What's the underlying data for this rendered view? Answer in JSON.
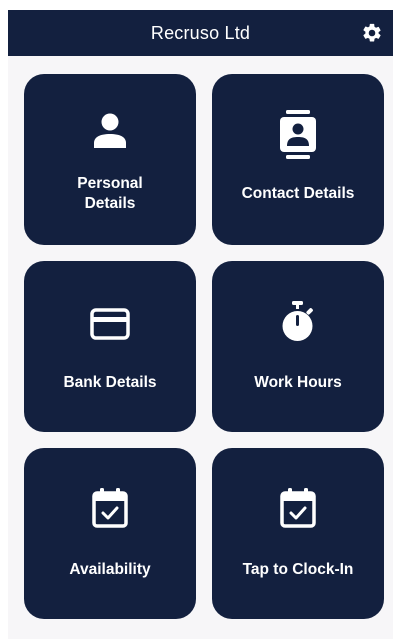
{
  "header": {
    "title": "Recruso Ltd",
    "settings_icon": "gear-icon"
  },
  "colors": {
    "brand_navy": "#13203f",
    "background": "#f7f6f8",
    "text_on_brand": "#ffffff"
  },
  "tiles": [
    {
      "label_line1": "Personal",
      "label_line2": "Details",
      "icon": "person-icon"
    },
    {
      "label": "Contact Details",
      "icon": "contact-card-icon"
    },
    {
      "label": "Bank Details",
      "icon": "credit-card-icon"
    },
    {
      "label": "Work Hours",
      "icon": "stopwatch-icon"
    },
    {
      "label": "Availability",
      "icon": "calendar-check-icon"
    },
    {
      "label": "Tap to Clock-In",
      "icon": "calendar-check-icon"
    }
  ]
}
